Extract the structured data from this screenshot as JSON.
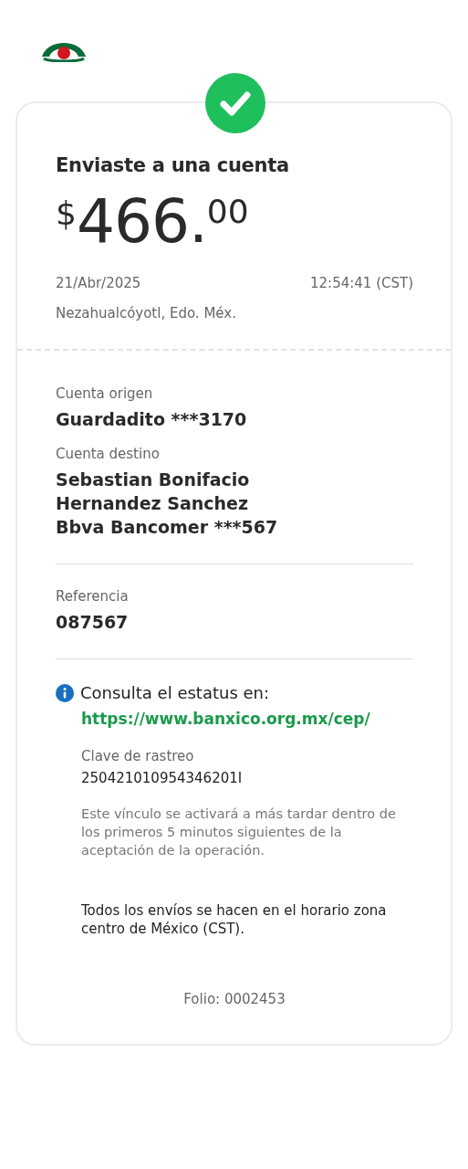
{
  "header": {
    "title": "Enviaste a una cuenta",
    "amount": {
      "currency": "$",
      "integer": "466.",
      "cents": "00"
    },
    "date": "21/Abr/2025",
    "time": "12:54:41 (CST)",
    "location": "Nezahualcóyotl, Edo. Méx."
  },
  "details": [
    {
      "label": "Cuenta origen",
      "lines": [
        "Guardadito ***3170"
      ]
    },
    {
      "label": "Cuenta destino",
      "lines": [
        "Sebastian Bonifacio",
        "Hernandez Sanchez",
        "Bbva Bancomer ***567"
      ]
    }
  ],
  "reference": {
    "label": "Referencia",
    "value": "087567"
  },
  "status": {
    "title": "Consulta el estatus en:",
    "link": "https://www.banxico.org.mx/cep/",
    "tracking_label": "Clave de rastreo",
    "tracking_value": "250421010954346201I",
    "note": "Este vínculo se activará a más tardar dentro de los primeros 5 minutos siguientes de la aceptación de la operación."
  },
  "footer_note": "Todos los envíos se hacen en el horario zona centro de México (CST).",
  "folio": "Folio: 0002453"
}
